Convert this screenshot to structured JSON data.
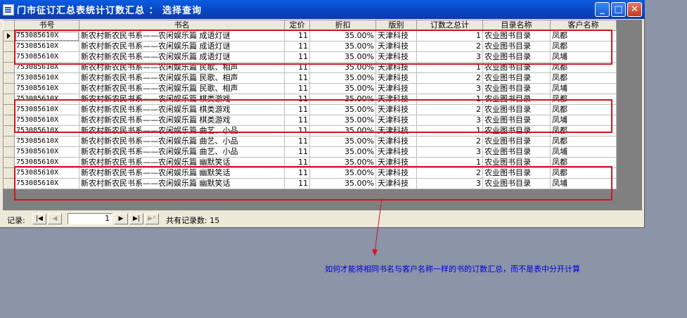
{
  "window": {
    "title": "门市征订汇总表统计订数汇总 ： 选择查询",
    "min_glyph": "_",
    "max_glyph": "□",
    "close_glyph": "✕"
  },
  "grid": {
    "columns": [
      "书号",
      "书名",
      "定价",
      "折扣",
      "版别",
      "订数之总计",
      "目录名称",
      "客户名称"
    ],
    "rows": [
      [
        "753085610X",
        "新农村新农民书系——农闲娱乐篇 成语灯谜",
        "11",
        "35.00%",
        "天津科技",
        "1",
        "农业图书目录",
        "凤都"
      ],
      [
        "753085610X",
        "新农村新农民书系——农闲娱乐篇 成语灯谜",
        "11",
        "35.00%",
        "天津科技",
        "2",
        "农业图书目录",
        "凤都"
      ],
      [
        "753085610X",
        "新农村新农民书系——农闲娱乐篇 成语灯谜",
        "11",
        "35.00%",
        "天津科技",
        "3",
        "农业图书目录",
        "凤埔"
      ],
      [
        "753085610X",
        "新农村新农民书系——农闲娱乐篇 民歌、相声",
        "11",
        "35.00%",
        "天津科技",
        "1",
        "农业图书目录",
        "凤都"
      ],
      [
        "753085610X",
        "新农村新农民书系——农闲娱乐篇 民歌、相声",
        "11",
        "35.00%",
        "天津科技",
        "2",
        "农业图书目录",
        "凤都"
      ],
      [
        "753085610X",
        "新农村新农民书系——农闲娱乐篇 民歌、相声",
        "11",
        "35.00%",
        "天津科技",
        "3",
        "农业图书目录",
        "凤埔"
      ],
      [
        "753085610X",
        "新农村新农民书系——农闲娱乐篇 棋类游戏",
        "11",
        "35.00%",
        "天津科技",
        "1",
        "农业图书目录",
        "凤都"
      ],
      [
        "753085610X",
        "新农村新农民书系——农闲娱乐篇 棋类游戏",
        "11",
        "35.00%",
        "天津科技",
        "2",
        "农业图书目录",
        "凤都"
      ],
      [
        "753085610X",
        "新农村新农民书系——农闲娱乐篇 棋类游戏",
        "11",
        "35.00%",
        "天津科技",
        "3",
        "农业图书目录",
        "凤埔"
      ],
      [
        "753085610X",
        "新农村新农民书系——农闲娱乐篇 曲艺、小品",
        "11",
        "35.00%",
        "天津科技",
        "1",
        "农业图书目录",
        "凤都"
      ],
      [
        "753085610X",
        "新农村新农民书系——农闲娱乐篇 曲艺、小品",
        "11",
        "35.00%",
        "天津科技",
        "2",
        "农业图书目录",
        "凤都"
      ],
      [
        "753085610X",
        "新农村新农民书系——农闲娱乐篇 曲艺、小品",
        "11",
        "35.00%",
        "天津科技",
        "3",
        "农业图书目录",
        "凤埔"
      ],
      [
        "753085610X",
        "新农村新农民书系——农闲娱乐篇 幽默笑话",
        "11",
        "35.00%",
        "天津科技",
        "1",
        "农业图书目录",
        "凤都"
      ],
      [
        "753085610X",
        "新农村新农民书系——农闲娱乐篇 幽默笑话",
        "11",
        "35.00%",
        "天津科技",
        "2",
        "农业图书目录",
        "凤都"
      ],
      [
        "753085610X",
        "新农村新农民书系——农闲娱乐篇 幽默笑话",
        "11",
        "35.00%",
        "天津科技",
        "3",
        "农业图书目录",
        "凤埔"
      ]
    ]
  },
  "navigation": {
    "record_label": "记录:",
    "current_record": "1",
    "total_label": "共有记录数: 15",
    "first_glyph": "|◀",
    "prev_glyph": "◀",
    "next_glyph": "▶",
    "last_glyph": "▶|",
    "new_glyph": "▶*"
  },
  "annotation": {
    "text": "如何才能将相同书名与客户名称一样的书的订数汇总，而不是表中分开计算",
    "color": "#d0151f"
  }
}
